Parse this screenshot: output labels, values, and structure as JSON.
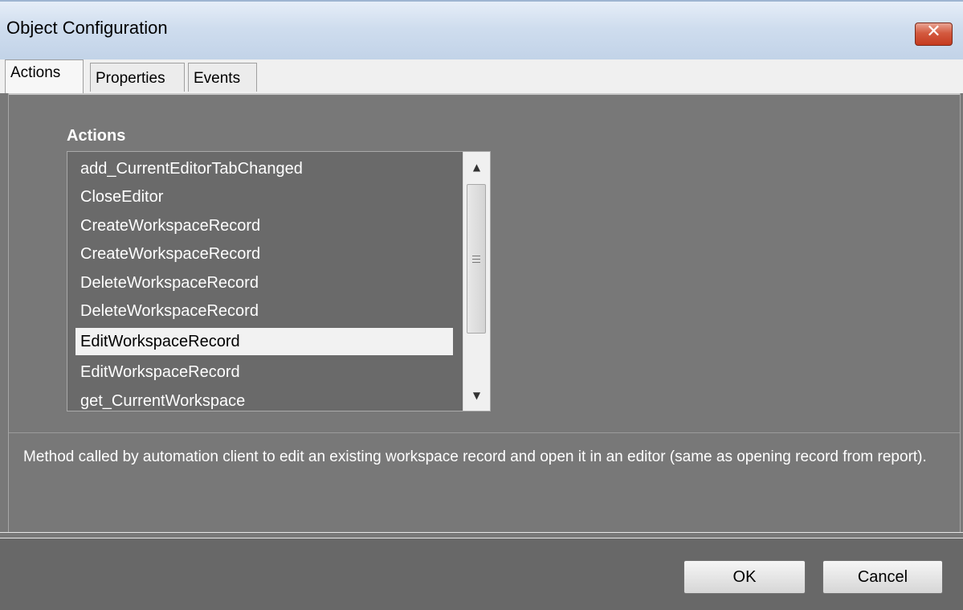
{
  "window": {
    "title": "Object Configuration",
    "close_icon": "close-icon"
  },
  "tabs": [
    {
      "label": "Actions",
      "active": true
    },
    {
      "label": "Properties",
      "active": false
    },
    {
      "label": "Events",
      "active": false
    }
  ],
  "actions": {
    "heading": "Actions",
    "items": [
      {
        "label": "add_CurrentEditorTabChanged",
        "selected": false
      },
      {
        "label": "CloseEditor",
        "selected": false
      },
      {
        "label": "CreateWorkspaceRecord",
        "selected": false
      },
      {
        "label": "CreateWorkspaceRecord",
        "selected": false
      },
      {
        "label": "DeleteWorkspaceRecord",
        "selected": false
      },
      {
        "label": "DeleteWorkspaceRecord",
        "selected": false
      },
      {
        "label": "EditWorkspaceRecord",
        "selected": true
      },
      {
        "label": "EditWorkspaceRecord",
        "selected": false
      },
      {
        "label": "get_CurrentWorkspace",
        "selected": false
      }
    ]
  },
  "description": "Method called by automation client to edit an existing workspace record and open it in an editor (same as opening record from report).",
  "buttons": {
    "ok": "OK",
    "cancel": "Cancel"
  }
}
